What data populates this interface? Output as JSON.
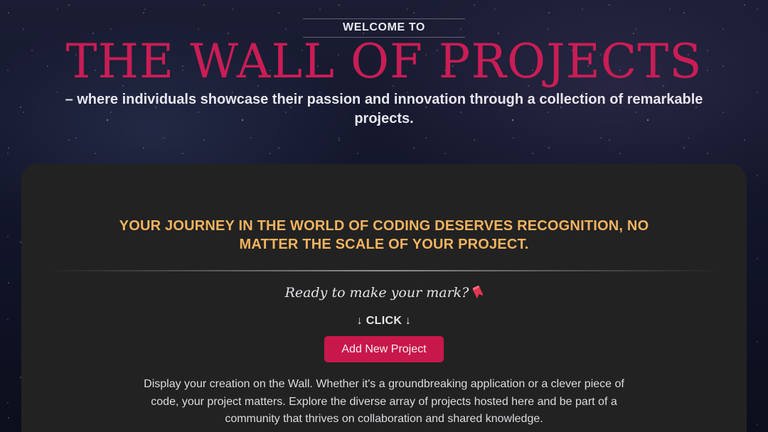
{
  "hero": {
    "welcome": "WELCOME TO",
    "title": "THE WALL OF PROJECTS",
    "subtitle": "– where individuals showcase their passion and innovation through a collection of remarkable projects."
  },
  "card": {
    "tagline": "YOUR JOURNEY IN THE WORLD OF CODING DESERVES RECOGNITION, NO MATTER THE SCALE OF YOUR PROJECT.",
    "prompt": "Ready to make your mark?",
    "prompt_icon": "bookmark-icon",
    "click_hint": "↓ CLICK ↓",
    "add_button_label": "Add New Project",
    "description": "Display your creation on the Wall. Whether it's a groundbreaking application or a clever piece of code, your project matters. Explore the diverse array of projects hosted here and be part of a community that thrives on collaboration and shared knowledge."
  },
  "colors": {
    "title": "#c91d55",
    "tagline": "#f2b35f",
    "button": "#c8184b",
    "card": "#222222"
  }
}
